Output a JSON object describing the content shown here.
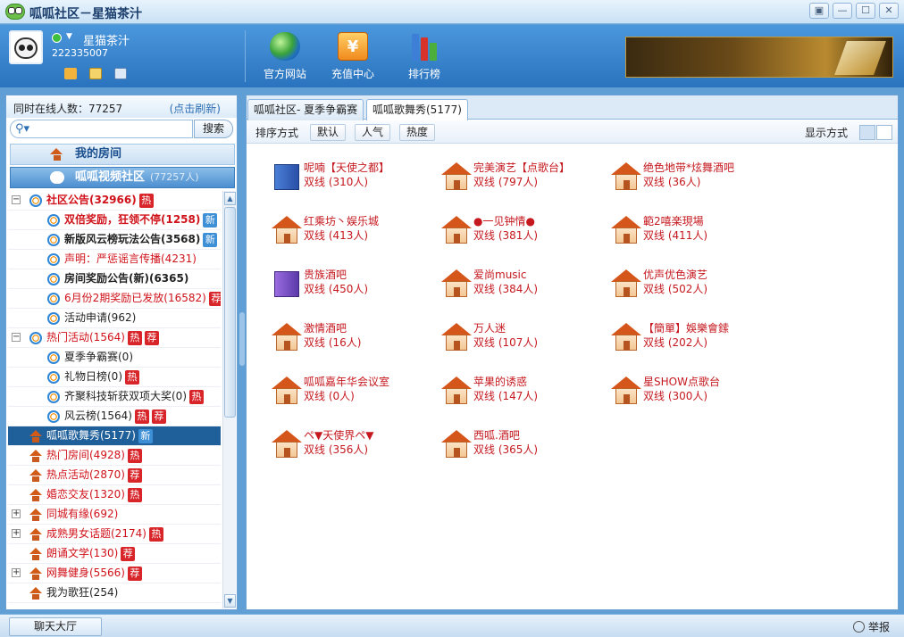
{
  "window": {
    "title": "呱呱社区－星猫茶汁",
    "buttons": [
      "▣",
      "—",
      "☐",
      "✕"
    ]
  },
  "user": {
    "nickname": "星猫茶汁",
    "id": "222335007"
  },
  "nav": [
    {
      "label": "官方网站",
      "icon": "globe-icon"
    },
    {
      "label": "充值中心",
      "icon": "yen-coin-icon",
      "glyph": "¥"
    },
    {
      "label": "排行榜",
      "icon": "ranking-bars-icon"
    }
  ],
  "sidebar": {
    "online_label": "同时在线人数：",
    "online_count": "77257",
    "refresh": "(点击刷新)",
    "search_placeholder": "",
    "search_button": "搜索",
    "my_room": "我的房间",
    "video_community": "呱呱视频社区",
    "video_community_count": "(77257人)",
    "items": [
      {
        "label": "社区公告(32966)",
        "level": 0,
        "expander": "−",
        "icon": "ie",
        "style": "red b",
        "tags": [
          "热"
        ]
      },
      {
        "label": "双倍奖励，狂领不停(1258)",
        "level": 1,
        "icon": "ie",
        "style": "red b",
        "tags": [
          "新"
        ]
      },
      {
        "label": "新版风云榜玩法公告(3568)",
        "level": 1,
        "icon": "ie",
        "style": "b",
        "tags": [
          "新"
        ]
      },
      {
        "label": "声明：严惩谣言传播(4231)",
        "level": 1,
        "icon": "ie",
        "style": "red",
        "tags": []
      },
      {
        "label": "房间奖励公告(新)(6365)",
        "level": 1,
        "icon": "ie",
        "style": "b",
        "tags": []
      },
      {
        "label": "6月份2期奖励已发放(16582)",
        "level": 1,
        "icon": "ie",
        "style": "red",
        "tags": [
          "荐"
        ]
      },
      {
        "label": "活动申请(962)",
        "level": 1,
        "icon": "ie",
        "style": "",
        "tags": []
      },
      {
        "label": "热门活动(1564)",
        "level": 0,
        "expander": "−",
        "icon": "ie",
        "style": "red",
        "tags": [
          "热",
          "荐"
        ]
      },
      {
        "label": "夏季争霸赛(0)",
        "level": 1,
        "icon": "ie",
        "style": "",
        "tags": []
      },
      {
        "label": "礼物日榜(0)",
        "level": 1,
        "icon": "ie",
        "style": "",
        "tags": [
          "热"
        ]
      },
      {
        "label": "齐聚科技斩获双项大奖(0)",
        "level": 1,
        "icon": "ie",
        "style": "",
        "tags": [
          "热"
        ]
      },
      {
        "label": "风云榜(1564)",
        "level": 1,
        "icon": "ie",
        "style": "",
        "tags": [
          "热",
          "荐"
        ]
      },
      {
        "label": "呱呱歌舞秀(5177)",
        "level": 0,
        "icon": "house",
        "style": "",
        "tags": [
          "新"
        ],
        "selected": true
      },
      {
        "label": "热门房间(4928)",
        "level": 0,
        "icon": "house",
        "style": "red",
        "tags": [
          "热"
        ]
      },
      {
        "label": "热点活动(2870)",
        "level": 0,
        "icon": "house",
        "style": "red",
        "tags": [
          "荐"
        ]
      },
      {
        "label": "婚恋交友(1320)",
        "level": 0,
        "icon": "house",
        "style": "red",
        "tags": [
          "热"
        ]
      },
      {
        "label": "同城有缘(692)",
        "level": 0,
        "expander": "+",
        "icon": "house",
        "style": "red",
        "tags": []
      },
      {
        "label": "成熟男女话题(2174)",
        "level": 0,
        "expander": "+",
        "icon": "house",
        "style": "red",
        "tags": [
          "热"
        ]
      },
      {
        "label": "朗诵文学(130)",
        "level": 0,
        "icon": "house",
        "style": "red",
        "tags": [
          "荐"
        ]
      },
      {
        "label": "网舞健身(5566)",
        "level": 0,
        "expander": "+",
        "icon": "house",
        "style": "red",
        "tags": [
          "荐"
        ]
      },
      {
        "label": "我为歌狂(254)",
        "level": 0,
        "icon": "house",
        "style": "",
        "tags": []
      }
    ]
  },
  "tabs": [
    {
      "label": "呱呱社区- 夏季争霸赛",
      "active": false
    },
    {
      "label": "呱呱歌舞秀(5177)",
      "active": true
    }
  ],
  "sortbar": {
    "label": "排序方式",
    "options": [
      "默认",
      "人气",
      "热度"
    ],
    "view_label": "显示方式"
  },
  "rooms": [
    {
      "name": "呢喃【天使之都】",
      "count": "双线 (310人)",
      "icon": "building"
    },
    {
      "name": "完美演艺【点歌台】",
      "count": "双线 (797人)",
      "icon": "house"
    },
    {
      "name": "绝色地带*炫舞酒吧",
      "count": "双线 (36人)",
      "icon": "house"
    },
    {
      "name": "红乘坊丶娱乐城",
      "count": "双线 (413人)",
      "icon": "house"
    },
    {
      "name": "●一见钟情●",
      "count": "双线 (381人)",
      "icon": "house"
    },
    {
      "name": "範2嘻楽現場",
      "count": "双线 (411人)",
      "icon": "house"
    },
    {
      "name": "贵族酒吧",
      "count": "双线 (450人)",
      "icon": "building-purple"
    },
    {
      "name": "爱尚music",
      "count": "双线 (384人)",
      "icon": "house-vip"
    },
    {
      "name": "优声优色演艺",
      "count": "双线 (502人)",
      "icon": "house"
    },
    {
      "name": "激情酒吧",
      "count": "双线 (16人)",
      "icon": "house"
    },
    {
      "name": "万人迷",
      "count": "双线 (107人)",
      "icon": "house"
    },
    {
      "name": "【簡單】娛樂會鎍",
      "count": "双线 (202人)",
      "icon": "house"
    },
    {
      "name": "呱呱嘉年华会议室",
      "count": "双线 (0人)",
      "icon": "house-locked"
    },
    {
      "name": "苹果的诱惑",
      "count": "双线 (147人)",
      "icon": "house"
    },
    {
      "name": "星SHOW点歌台",
      "count": "双线 (300人)",
      "icon": "house"
    },
    {
      "name": "ペ▼天使界ペ▼",
      "count": "双线 (356人)",
      "icon": "house"
    },
    {
      "name": "西呱.酒吧",
      "count": "双线 (365人)",
      "icon": "house"
    }
  ],
  "statusbar": {
    "chat_hall": "聊天大厅",
    "report": "举报"
  },
  "colors": {
    "accent": "#2a73be",
    "room_text": "#c5191f",
    "tag_red": "#d8252a",
    "tag_blue": "#3d8fd6"
  }
}
